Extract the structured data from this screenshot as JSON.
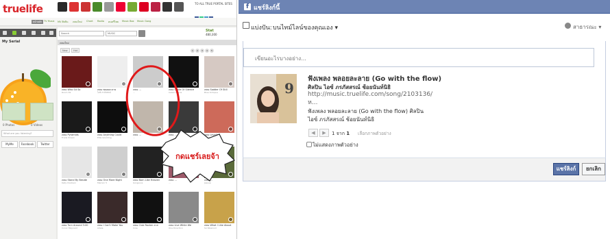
{
  "left": {
    "logo": "truelife",
    "portal_text": "TO ALL TRUE PORTAL SITES",
    "nav": [
      "หน้าหลัก",
      "TV Music",
      "MV ศิลปิน",
      "เพลงใหม่",
      "Chart",
      "Radio",
      "ดนตรีไทย",
      "Music Box",
      "Music Gang"
    ],
    "sidebar": {
      "title": "My Serial",
      "stats": [
        "0 Photos",
        "0 Videos"
      ],
      "input_placeholder": "What are you listening?",
      "buttons": [
        "MyMe",
        "Facebook",
        "Twitter"
      ]
    },
    "search": {
      "placeholder": "Search",
      "category": "MUSIC"
    },
    "stat": {
      "label": "Stat",
      "value": "480,300"
    },
    "section_title": "เพลงใหม่",
    "tabs": [
      "New",
      "Hot"
    ],
    "pages": [
      "1",
      "2",
      "3",
      "4",
      "5"
    ],
    "speech_bubble": "กดแชร์เลยจ้า",
    "grid": [
      {
        "title": "เพลง Who Sit So",
        "artist": "Room 39"
      },
      {
        "title": "เพลง พลอยละลาย",
        "artist": "ไอซ์ ภรภัสสรณ์"
      },
      {
        "title": "เพลง ...",
        "artist": "..."
      },
      {
        "title": "เพลง Circle Of Silence",
        "artist": "Calvin Harris"
      },
      {
        "title": "เพลง Sadder Of Still",
        "artist": "Blue Octopus"
      },
      {
        "title": "เพลง Pyramids",
        "artist": "Frank Ocean"
      },
      {
        "title": "เพลง Anything Could",
        "artist": "Ellie Goulding"
      },
      {
        "title": "เพลง ...",
        "artist": "..."
      },
      {
        "title": "เพลง ...",
        "artist": "..."
      },
      {
        "title": "เพลง Levelled",
        "artist": "Iggy Pop"
      },
      {
        "title": "เพลง Stand By Beside",
        "artist": "Kelly Clarkson"
      },
      {
        "title": "เพลง One More Night",
        "artist": "Maroon 5"
      },
      {
        "title": "เพลง Born Like Heaven",
        "artist": "Gorgeous"
      },
      {
        "title": "เพลง ...",
        "artist": "..."
      },
      {
        "title": "เพลง ...",
        "artist": "Jessup"
      },
      {
        "title": "เพลง Turn Around 3:00",
        "artist": "Conor Maynard"
      },
      {
        "title": "เพลง I Can't Make You",
        "artist": "Adele"
      },
      {
        "title": "เพลง Club Rocker ลาส",
        "artist": "Inna"
      },
      {
        "title": "เพลง Live While We",
        "artist": "One Direction"
      },
      {
        "title": "เพลง What I Like About",
        "artist": "Scribbelood"
      }
    ]
  },
  "fb": {
    "title": "แชร์ลิงก์นี้",
    "share_label": "แบ่งปัน:",
    "share_target": "บนไทม์ไลน์ของคุณเอง",
    "privacy": "สาธารณะ",
    "message_placeholder": "เขียนอะไรบางอย่าง...",
    "link_title": "ฟังเพลง พลอยละลาย (Go with the flow)",
    "link_artist": "ศิลปิน ไอซ์ ภรภัสสรณ์ ช้อยนันท์นิธิ",
    "link_url_1": "http://music.truelife.com/song/2103136/",
    "link_url_2": "ห...",
    "link_desc_1": "ฟังเพลง พลอยละลาย (Go with the flow) ศิลปิน",
    "link_desc_2": "ไอซ์ ภรภัสสรณ์ ช้อยนันท์นิธิ",
    "pager_current": "1",
    "pager_of": "จาก",
    "pager_total": "1",
    "pager_label": "เลือกภาพตัวอย่าง",
    "pager_prev": "◀",
    "pager_next": "▶",
    "no_thumb": "ไม่แสดงภาพตัวอย่าง",
    "btn_share": "แชร์ลิงก์",
    "btn_cancel": "ยกเลิก",
    "accent": "#6d84b4"
  }
}
